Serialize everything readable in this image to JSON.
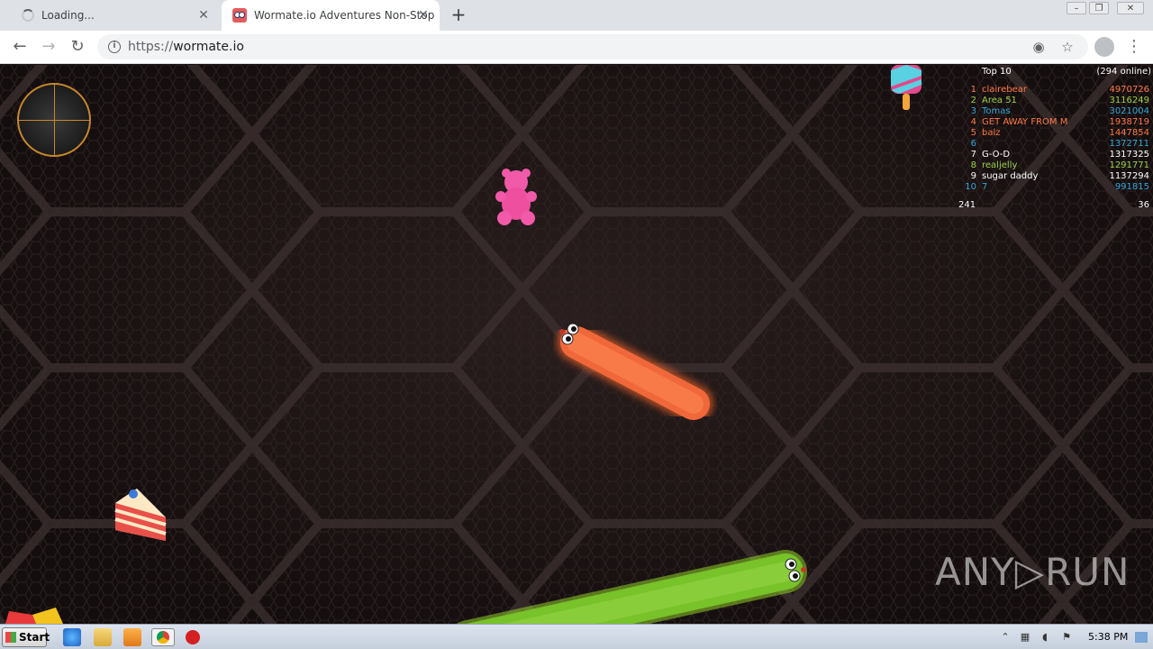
{
  "browser": {
    "tabs": [
      {
        "label": "Loading...",
        "state": "loading"
      },
      {
        "label": "Wormate.io Adventures Non-Stop",
        "state": "active"
      }
    ],
    "url_scheme": "https://",
    "url_host": "wormate.io",
    "new_tab_glyph": "+",
    "close_glyph": "✕"
  },
  "game": {
    "leaderboard": {
      "title": "Top 10",
      "online": "(294 online)",
      "rows": [
        {
          "rank": "1",
          "name": "clairebear",
          "score": "4970726",
          "color": "#ff7a45"
        },
        {
          "rank": "2",
          "name": "Area 51",
          "score": "3116249",
          "color": "#9bd14a"
        },
        {
          "rank": "3",
          "name": "Tomas",
          "score": "3021004",
          "color": "#35a8d8"
        },
        {
          "rank": "4",
          "name": "GET AWAY FROM M",
          "score": "1938719",
          "color": "#ff7a45"
        },
        {
          "rank": "5",
          "name": "balz",
          "score": "1447854",
          "color": "#ff7a45"
        },
        {
          "rank": "6",
          "name": "",
          "score": "1372711",
          "color": "#35a8d8"
        },
        {
          "rank": "7",
          "name": "G-O-D",
          "score": "1317325",
          "color": "#ffffff"
        },
        {
          "rank": "8",
          "name": "realjelly",
          "score": "1291771",
          "color": "#9bd14a"
        },
        {
          "rank": "9",
          "name": "sugar daddy",
          "score": "1137294",
          "color": "#ffffff"
        },
        {
          "rank": "10",
          "name": "7",
          "score": "991815",
          "color": "#35a8d8"
        }
      ],
      "footer_left": "241",
      "footer_right": "36"
    },
    "watermark": "ANY▷RUN"
  },
  "taskbar": {
    "start_label": "Start",
    "clock": "5:38 PM"
  }
}
